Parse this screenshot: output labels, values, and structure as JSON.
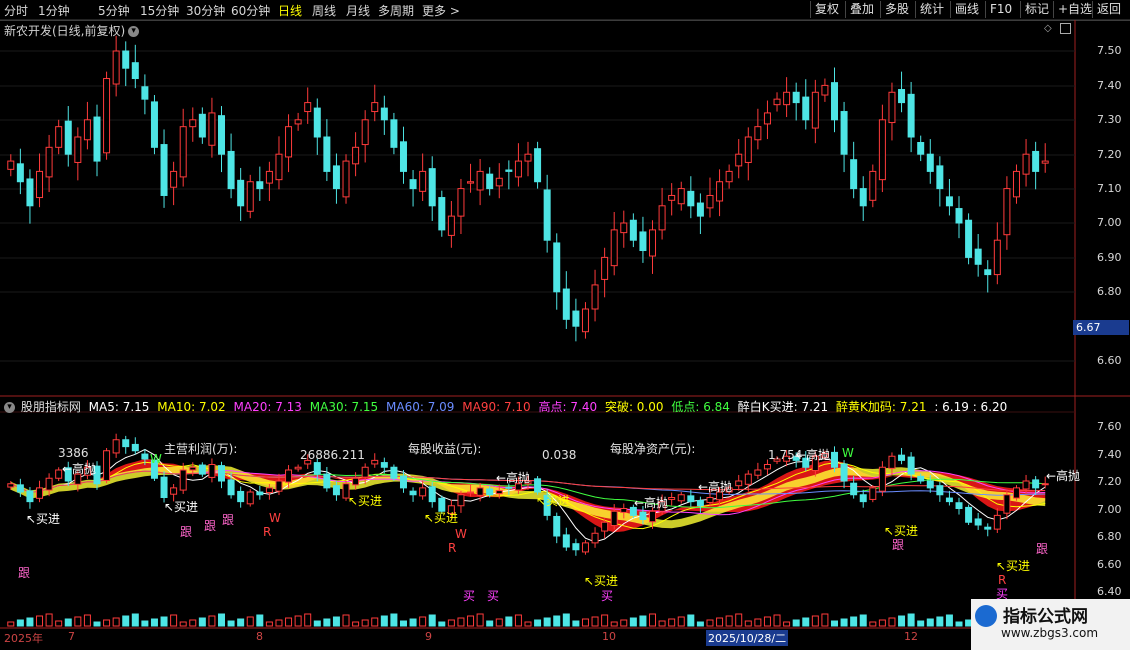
{
  "toolbar": {
    "periods": [
      "分时",
      "1分钟",
      "5分钟",
      "15分钟",
      "30分钟",
      "60分钟",
      "日线",
      "周线",
      "月线",
      "多周期",
      "更多 >"
    ],
    "active_period": "日线",
    "right_buttons": [
      "复权",
      "叠加",
      "多股",
      "统计",
      "画线",
      "F10",
      "标记",
      "+自选",
      "返回"
    ]
  },
  "main_chart": {
    "title": "新农开发(日线,前复权)",
    "current_price_tag": "6.67",
    "y_axis_labels": [
      "7.50",
      "7.40",
      "7.30",
      "7.20",
      "7.10",
      "7.00",
      "6.90",
      "6.80",
      "6.60"
    ]
  },
  "indicator": {
    "name": "股朋指标网",
    "ma5": "MA5: 7.15",
    "ma10": "MA10: 7.02",
    "ma20": "MA20: 7.13",
    "ma30": "MA30: 7.15",
    "ma60": "MA60: 7.09",
    "ma90": "MA90: 7.10",
    "gaodian": "高点: 7.40",
    "tupo": "突破: 0.00",
    "didian": "低点: 6.84",
    "zuibai": "醉白K买进: 7.21",
    "zuihuang": "醉黄K加码: 7.21",
    "extra": ": 6.19 : 6.20",
    "y_axis_labels": [
      "7.60",
      "7.40",
      "7.20",
      "7.00",
      "6.80",
      "6.60",
      "6.40"
    ],
    "labels": {
      "main_profit": "主营利润(万):",
      "main_profit_val": "26886.211",
      "eps": "每股收益(元):",
      "eps_val": "0.038",
      "bvps": "每股净资产(元):",
      "bvps_val": "1.754",
      "val_3386": "3386",
      "gaopao": "←高抛",
      "maijin": "↖买进",
      "gen": "跟",
      "mai": "买",
      "w": "W",
      "r": "R"
    }
  },
  "x_axis": {
    "labels": [
      "2025年",
      "7",
      "8",
      "9",
      "10",
      "2025/10/28/二",
      "12"
    ]
  },
  "watermark": {
    "title": "指标公式网",
    "url": "www.zbgs3.com"
  },
  "colors": {
    "up": "#ff3b3b",
    "down": "#4ee5e5",
    "ma5": "#ffffff",
    "ma10": "#ffff00",
    "ma20": "#ff40ff",
    "ma30": "#40ff40",
    "ma60": "#6a8cff",
    "ma90": "#ff4040"
  }
}
